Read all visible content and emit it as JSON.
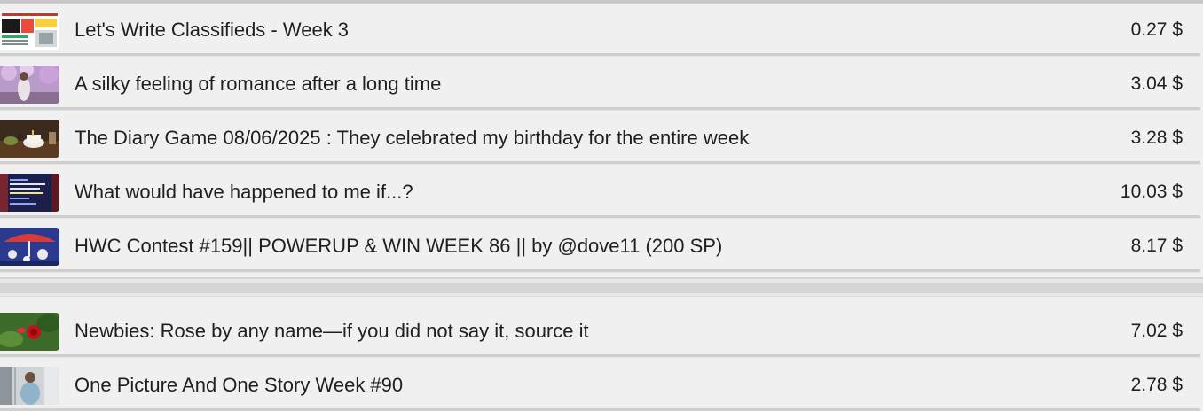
{
  "posts": [
    {
      "title": "Let's Write Classifieds - Week 3",
      "payout": "0.27 $",
      "thumbnail": "classifieds-collage-thumbnail"
    },
    {
      "title": "A silky feeling of romance after a long time",
      "payout": "3.04 $",
      "thumbnail": "blossom-tree-portrait-thumbnail"
    },
    {
      "title": "The Diary Game 08/06/2025 : They celebrated my birthday for the entire week",
      "payout": "3.28 $",
      "thumbnail": "birthday-cake-thumbnail"
    },
    {
      "title": "What would have happened to me if...?",
      "payout": "10.03 $",
      "thumbnail": "dark-blue-text-thumbnail"
    },
    {
      "title": "HWC Contest #159|| POWERUP & WIN WEEK 86 || by @dove11 (200 SP)",
      "payout": "8.17 $",
      "thumbnail": "red-umbrella-thumbnail"
    },
    {
      "title": "Newbies: Rose by any name—if you did not say it, source it",
      "payout": "7.02 $",
      "thumbnail": "red-rose-thumbnail"
    },
    {
      "title": "One Picture And One Story Week #90",
      "payout": "2.78 $",
      "thumbnail": "street-photo-thumbnail"
    }
  ]
}
